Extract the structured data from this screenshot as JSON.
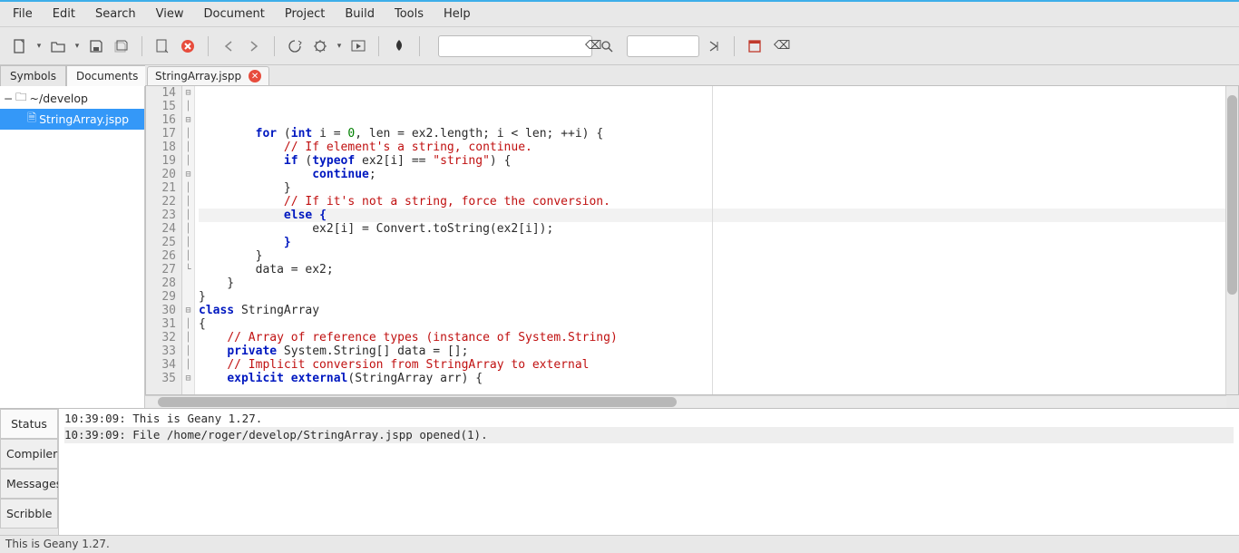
{
  "menu": {
    "items": [
      "File",
      "Edit",
      "Search",
      "View",
      "Document",
      "Project",
      "Build",
      "Tools",
      "Help"
    ]
  },
  "toolbar": {
    "icons": [
      "new",
      "open",
      "save",
      "save-all",
      "close",
      "close-all",
      "nav-back",
      "nav-fwd",
      "reload",
      "build",
      "run",
      "terminal",
      "color-picker"
    ],
    "search1_placeholder": "",
    "search2_placeholder": ""
  },
  "sidebar": {
    "tabs": [
      "Symbols",
      "Documents"
    ],
    "active_tab": 1,
    "tree": {
      "root": "~/develop",
      "file": "StringArray.jspp"
    }
  },
  "editor": {
    "tab_label": "StringArray.jspp",
    "first_line_no": 14,
    "highlight_line": 20,
    "lines": [
      {
        "fold": "⊟",
        "tokens": [
          [
            "        ",
            ""
          ],
          [
            "for",
            1
          ],
          [
            " (",
            ""
          ],
          [
            "int",
            1
          ],
          [
            " i = ",
            ""
          ],
          [
            "0",
            3
          ],
          [
            ", len = ex2.length; i < len; ++i) {",
            ""
          ]
        ]
      },
      {
        "fold": "│",
        "tokens": [
          [
            "            ",
            ""
          ],
          [
            "// If element's a string, continue.",
            2
          ]
        ]
      },
      {
        "fold": "⊟",
        "tokens": [
          [
            "            ",
            ""
          ],
          [
            "if",
            1
          ],
          [
            " (",
            ""
          ],
          [
            "typeof",
            1
          ],
          [
            " ex2[i] == ",
            ""
          ],
          [
            "\"string\"",
            2
          ],
          [
            ") {",
            ""
          ]
        ]
      },
      {
        "fold": "│",
        "tokens": [
          [
            "                ",
            ""
          ],
          [
            "continue",
            1
          ],
          [
            ";",
            ""
          ]
        ]
      },
      {
        "fold": "│",
        "tokens": [
          [
            "            }",
            ""
          ]
        ]
      },
      {
        "fold": "│",
        "tokens": [
          [
            "            ",
            ""
          ],
          [
            "// If it's not a string, force the conversion.",
            2
          ]
        ]
      },
      {
        "fold": "⊟",
        "tokens": [
          [
            "            ",
            ""
          ],
          [
            "else",
            1
          ],
          [
            " ",
            ""
          ],
          [
            "{",
            1
          ]
        ]
      },
      {
        "fold": "│",
        "tokens": [
          [
            "                ex2[i] = Convert.toString(ex2[i]);",
            ""
          ]
        ]
      },
      {
        "fold": "│",
        "tokens": [
          [
            "            ",
            ""
          ],
          [
            "}",
            1
          ]
        ]
      },
      {
        "fold": "│",
        "tokens": [
          [
            "        }",
            ""
          ]
        ]
      },
      {
        "fold": "│",
        "tokens": [
          [
            "",
            ""
          ]
        ]
      },
      {
        "fold": "│",
        "tokens": [
          [
            "        data = ex2;",
            ""
          ]
        ]
      },
      {
        "fold": "│",
        "tokens": [
          [
            "    }",
            ""
          ]
        ]
      },
      {
        "fold": "└",
        "tokens": [
          [
            "}",
            ""
          ]
        ]
      },
      {
        "fold": "",
        "tokens": [
          [
            "",
            ""
          ]
        ]
      },
      {
        "fold": "",
        "tokens": [
          [
            "",
            ""
          ],
          [
            "class",
            1
          ],
          [
            " StringArray",
            ""
          ]
        ]
      },
      {
        "fold": "⊟",
        "tokens": [
          [
            "{",
            ""
          ]
        ]
      },
      {
        "fold": "│",
        "tokens": [
          [
            "    ",
            ""
          ],
          [
            "// Array of reference types (instance of System.String)",
            2
          ]
        ]
      },
      {
        "fold": "│",
        "tokens": [
          [
            "    ",
            ""
          ],
          [
            "private",
            1
          ],
          [
            " System.String[] data = [];",
            ""
          ]
        ]
      },
      {
        "fold": "│",
        "tokens": [
          [
            "",
            ""
          ]
        ]
      },
      {
        "fold": "│",
        "tokens": [
          [
            "    ",
            ""
          ],
          [
            "// Implicit conversion from StringArray to external",
            2
          ]
        ]
      },
      {
        "fold": "⊟",
        "tokens": [
          [
            "    ",
            ""
          ],
          [
            "explicit",
            1
          ],
          [
            " ",
            ""
          ],
          [
            "external",
            1
          ],
          [
            "(StringArray arr) {",
            ""
          ]
        ]
      }
    ]
  },
  "bottom": {
    "tabs": [
      "Status",
      "Compiler",
      "Messages",
      "Scribble"
    ],
    "active_tab": 0,
    "log": [
      "10:39:09: This is Geany 1.27.",
      "10:39:09: File /home/roger/develop/StringArray.jspp opened(1)."
    ],
    "selected_log_line": 1
  },
  "statusbar": "This is Geany 1.27."
}
